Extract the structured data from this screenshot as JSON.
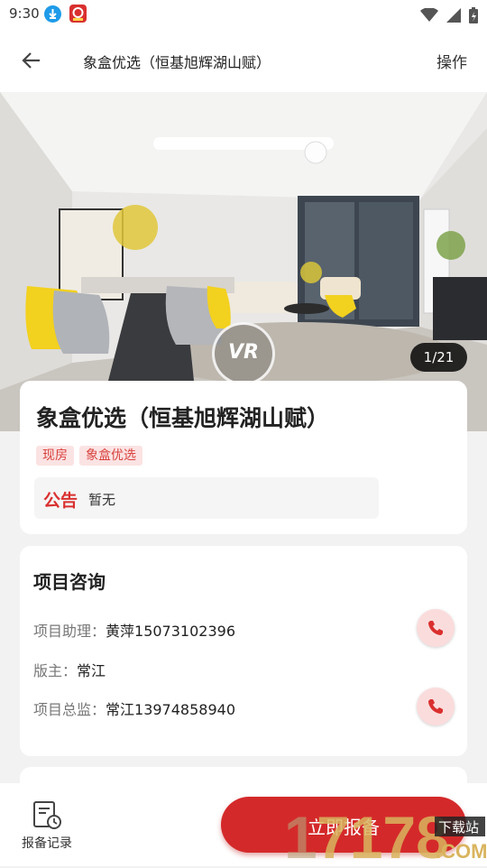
{
  "status_bar": {
    "time": "9:30"
  },
  "header": {
    "title": "象盒优选（恒基旭辉湖山赋）",
    "action_label": "操作"
  },
  "gallery": {
    "vr_label": "VR",
    "counter": "1/21"
  },
  "project": {
    "title": "象盒优选（恒基旭辉湖山赋）",
    "tags": [
      "现房",
      "象盒优选"
    ],
    "notice_label": "公告",
    "notice_text": "暂无"
  },
  "consult": {
    "title": "项目咨询",
    "rows": [
      {
        "key": "项目助理：",
        "value": "黄萍15073102396",
        "callable": true
      },
      {
        "key": "版主：",
        "value": "常江",
        "callable": false
      },
      {
        "key": "项目总监：",
        "value": "常江13974858940",
        "callable": true
      }
    ]
  },
  "bottom": {
    "record_label": "报备记录",
    "report_label": "立即报备"
  },
  "watermark": {
    "left": "1",
    "mid": "7178",
    "tag": "下载站",
    "dom": ".COM"
  },
  "colors": {
    "brand_red": "#d4292a",
    "tag_bg": "#fbe3e3",
    "tag_text": "#d8433f"
  }
}
